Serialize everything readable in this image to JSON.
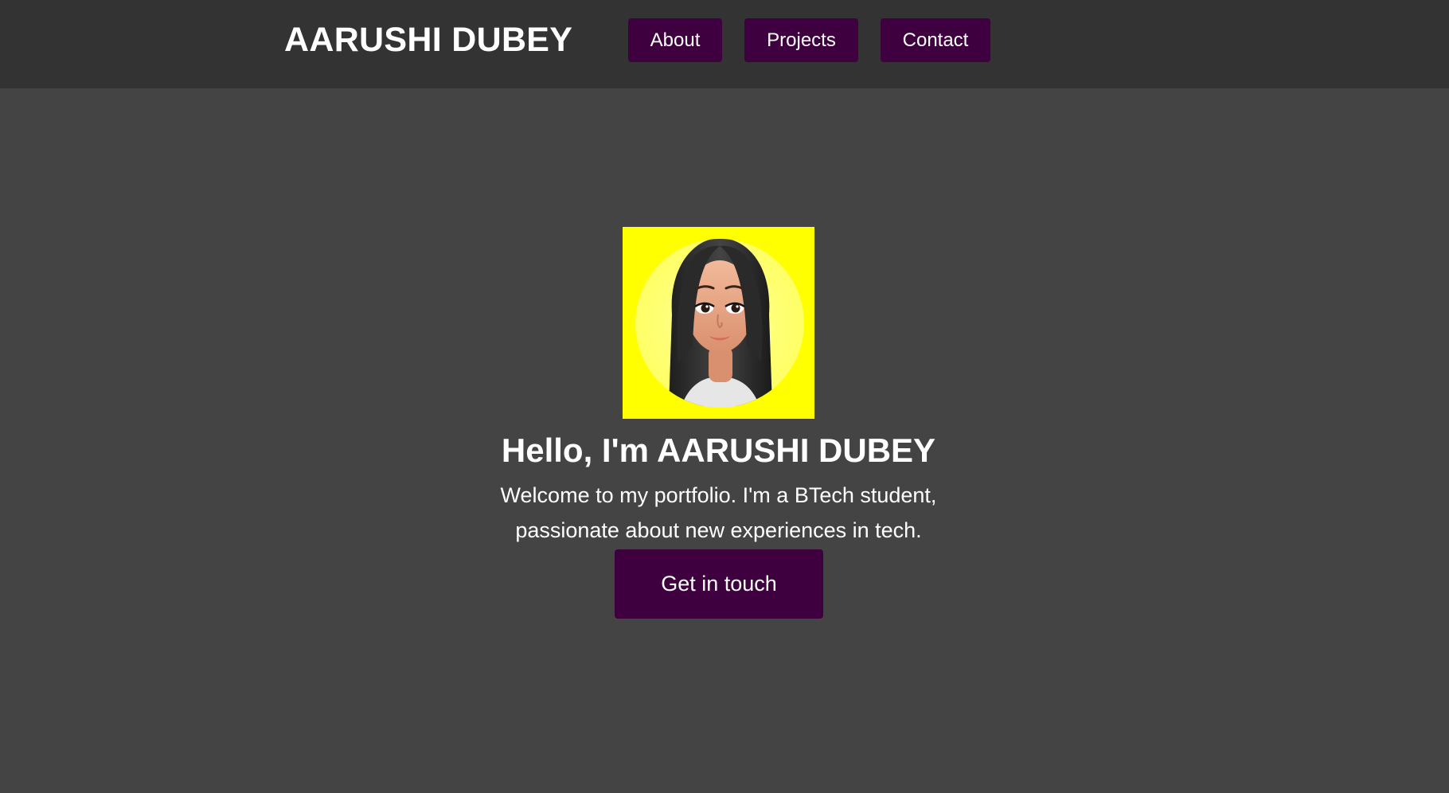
{
  "header": {
    "brand": "AARUSHI DUBEY",
    "nav": {
      "about": "About",
      "projects": "Projects",
      "contact": "Contact"
    }
  },
  "hero": {
    "avatar_icon": "avatar-illustration",
    "title": "Hello, I'm AARUSHI DUBEY",
    "text_line1": "Welcome to my portfolio. I'm a BTech student,",
    "text_line2": "passionate about new experiences in tech.",
    "cta_label": "Get in touch"
  },
  "colors": {
    "page_background": "#444444",
    "header_background": "#333333",
    "button_background": "#3f0040",
    "avatar_background": "#ffff00",
    "text": "#ffffff"
  }
}
